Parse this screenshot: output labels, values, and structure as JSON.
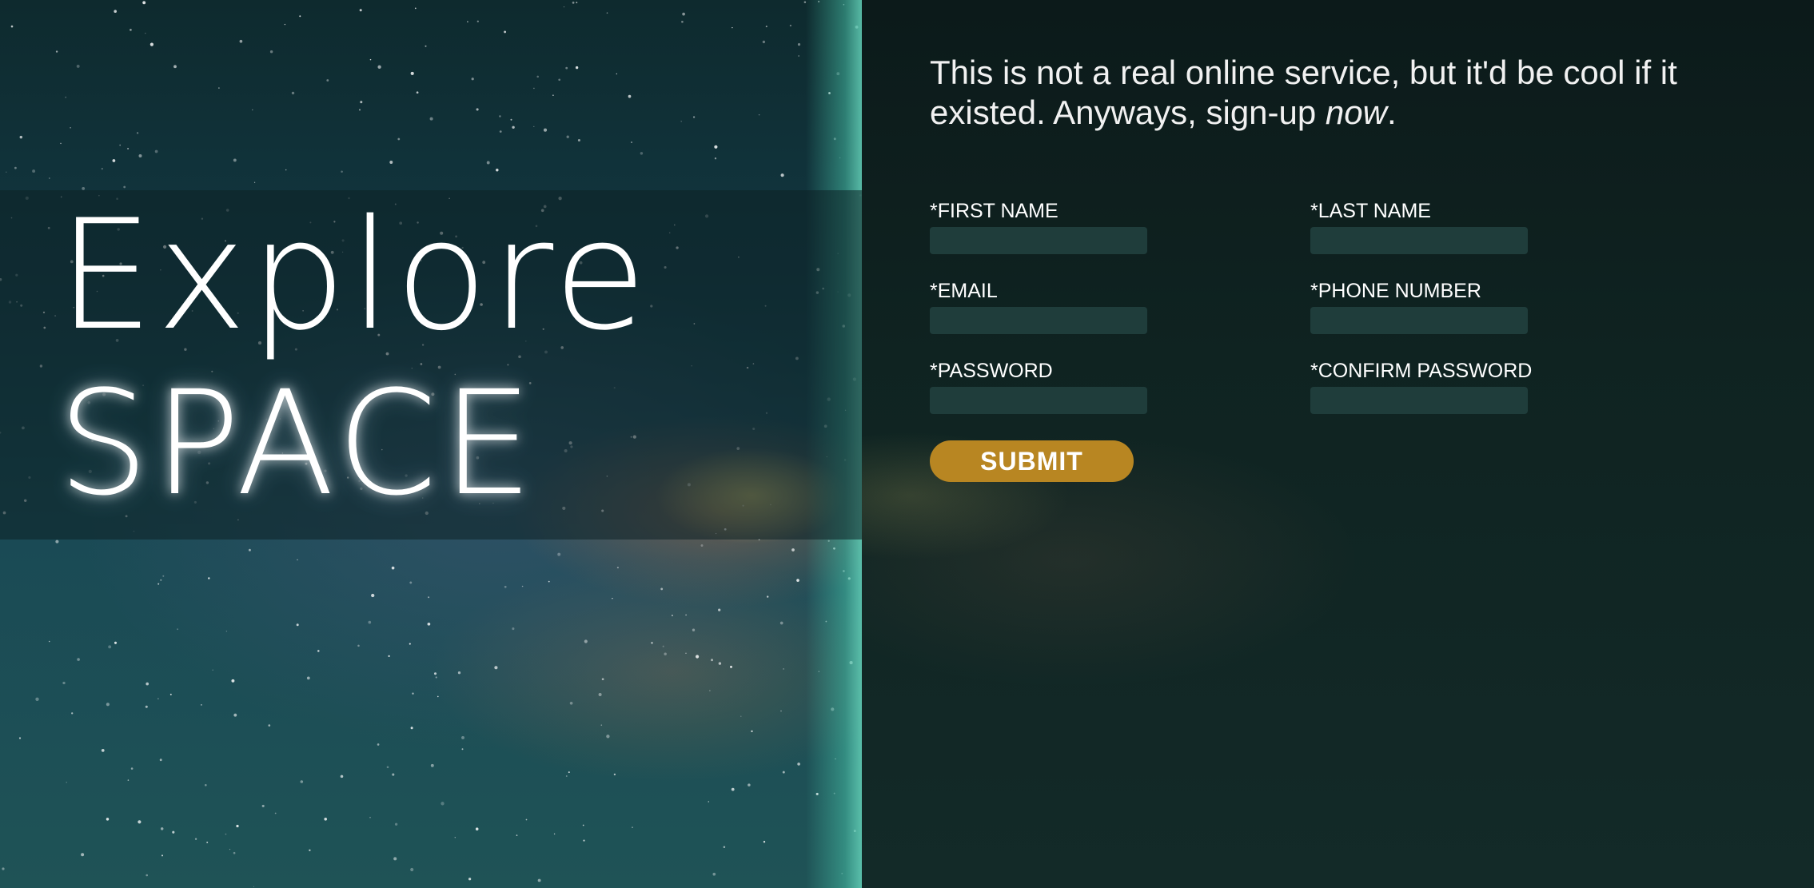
{
  "hero": {
    "title_line1": "Explore",
    "title_line2": "SPACE"
  },
  "intro": {
    "text_before": "This is not a real online service, but it'd be cool if it existed. Anyways, sign-up ",
    "emphasis": "now",
    "text_after": "."
  },
  "form": {
    "fields": [
      {
        "label": "*FIRST NAME",
        "value": ""
      },
      {
        "label": "*LAST NAME",
        "value": ""
      },
      {
        "label": "*EMAIL",
        "value": ""
      },
      {
        "label": "*PHONE NUMBER",
        "value": ""
      },
      {
        "label": "*PASSWORD",
        "value": ""
      },
      {
        "label": "*CONFIRM PASSWORD",
        "value": ""
      }
    ],
    "submit_label": "SUBMIT"
  },
  "colors": {
    "submit_button": "#b88622",
    "input_background": "#1f3d3b",
    "panel_background": "#0f2321"
  }
}
